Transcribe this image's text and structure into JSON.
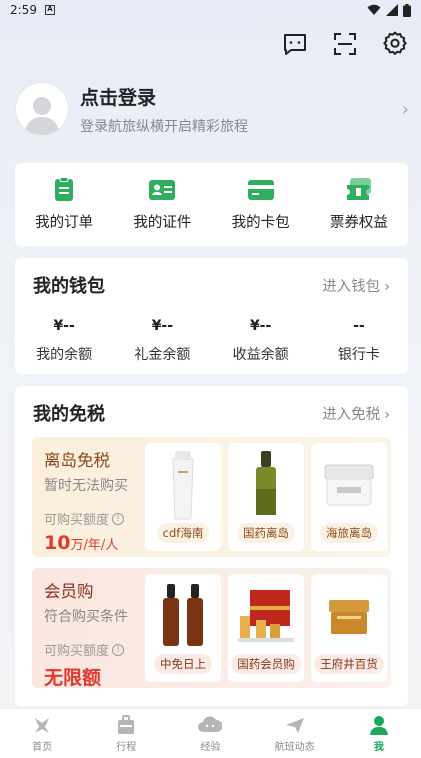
{
  "status_bar": {
    "time": "2:59"
  },
  "profile": {
    "title": "点击登录",
    "subtitle": "登录航旅纵横开启精彩旅程"
  },
  "quick_actions": [
    {
      "label": "我的订单",
      "icon": "order-icon"
    },
    {
      "label": "我的证件",
      "icon": "id-card-icon"
    },
    {
      "label": "我的卡包",
      "icon": "card-wallet-icon"
    },
    {
      "label": "票券权益",
      "icon": "ticket-icon"
    }
  ],
  "wallet": {
    "title": "我的钱包",
    "link": "进入钱包",
    "items": [
      {
        "value": "¥--",
        "label": "我的余额"
      },
      {
        "value": "¥--",
        "label": "礼金余额"
      },
      {
        "value": "¥--",
        "label": "收益余额"
      },
      {
        "value": "--",
        "label": "银行卡"
      }
    ]
  },
  "duty_free": {
    "title": "我的免税",
    "link": "进入免税",
    "island": {
      "name": "离岛免税",
      "desc": "暂时无法购买",
      "quota_label": "可购买额度",
      "amount": "10",
      "amount_unit": "万/年/人",
      "products": [
        {
          "tag": "cdf海南"
        },
        {
          "tag": "国药离岛"
        },
        {
          "tag": "海旅离岛"
        }
      ]
    },
    "member": {
      "name": "会员购",
      "desc": "符合购买条件",
      "quota_label": "可购买额度",
      "amount": "无限额",
      "products": [
        {
          "tag": "中免日上"
        },
        {
          "tag": "国药会员购"
        },
        {
          "tag": "王府井百货"
        }
      ]
    }
  },
  "tabbar": [
    {
      "label": "首页",
      "active": false
    },
    {
      "label": "行程",
      "active": false
    },
    {
      "label": "经验",
      "active": false
    },
    {
      "label": "航班动态",
      "active": false
    },
    {
      "label": "我",
      "active": true
    }
  ],
  "colors": {
    "accent_green": "#1aa85a",
    "highlight_red": "#e23b2e"
  }
}
